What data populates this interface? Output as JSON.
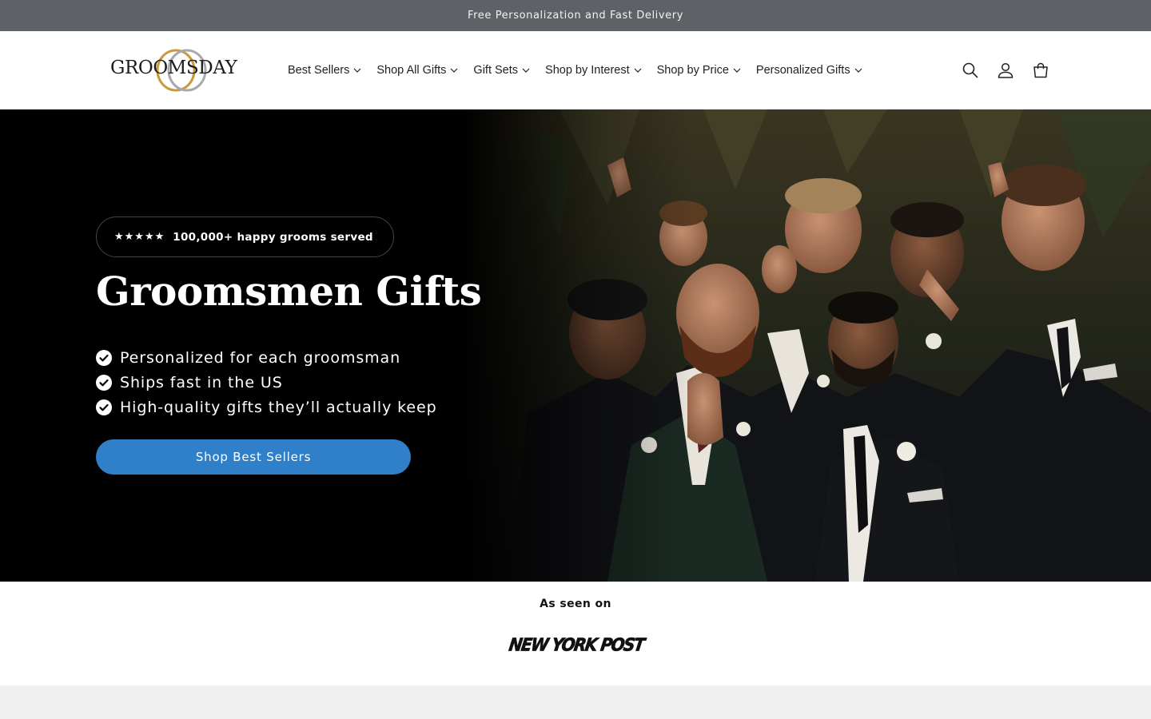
{
  "announcement": {
    "text": "Free Personalization and Fast Delivery"
  },
  "header": {
    "logo_text": "GROOMSDAY",
    "nav": [
      {
        "label": "Best Sellers"
      },
      {
        "label": "Shop All Gifts"
      },
      {
        "label": "Gift Sets"
      },
      {
        "label": "Shop by Interest"
      },
      {
        "label": "Shop by Price"
      },
      {
        "label": "Personalized Gifts"
      }
    ],
    "icons": [
      "search-icon",
      "account-icon",
      "cart-icon"
    ]
  },
  "hero": {
    "badge_stars": "★★★★★",
    "badge_text": "100,000+ happy grooms served",
    "title": "Groomsmen Gifts",
    "bullets": [
      "Personalized for each groomsman",
      "Ships fast in the US",
      "High-quality gifts they’ll actually keep"
    ],
    "cta_label": "Shop Best Sellers"
  },
  "press": {
    "label": "As seen on",
    "logos": [
      "NEW YORK POST"
    ]
  },
  "colors": {
    "announcement_bg": "#5e6166",
    "cta": "#2f7fc9",
    "hero_bg": "#000000"
  }
}
